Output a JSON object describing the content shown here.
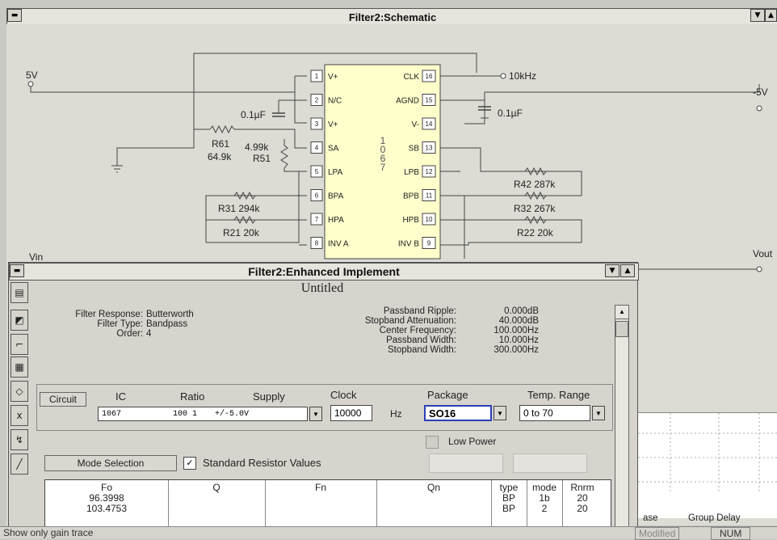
{
  "schematic": {
    "title": "Filter2:Schematic",
    "ic": {
      "part_digits": [
        "1",
        "0",
        "6",
        "7"
      ],
      "pins_left": [
        {
          "num": "1",
          "name": "V+"
        },
        {
          "num": "2",
          "name": "N/C"
        },
        {
          "num": "3",
          "name": "V+"
        },
        {
          "num": "4",
          "name": "SA"
        },
        {
          "num": "5",
          "name": "LPA"
        },
        {
          "num": "6",
          "name": "BPA"
        },
        {
          "num": "7",
          "name": "HPA"
        },
        {
          "num": "8",
          "name": "INV A"
        }
      ],
      "pins_right": [
        {
          "num": "16",
          "name": "CLK"
        },
        {
          "num": "15",
          "name": "AGND"
        },
        {
          "num": "14",
          "name": "V-"
        },
        {
          "num": "13",
          "name": "SB"
        },
        {
          "num": "12",
          "name": "LPB"
        },
        {
          "num": "11",
          "name": "BPB"
        },
        {
          "num": "10",
          "name": "HPB"
        },
        {
          "num": "9",
          "name": "INV B"
        }
      ]
    },
    "labels": {
      "vplus": "5V",
      "vminus": "-5V",
      "clock": "10kHz",
      "cap_left": "0.1µF",
      "cap_right": "0.1µF",
      "r61_name": "R61",
      "r61_val": "64.9k",
      "r51_val": "4.99k",
      "r51_name": "R51",
      "r31": "R31 294k",
      "r21": "R21 20k",
      "r42": "R42 287k",
      "r32": "R32 267k",
      "r22": "R22 20k",
      "vin": "Vin",
      "vout": "Vout"
    }
  },
  "dialog": {
    "title": "Filter2:Enhanced Implement",
    "subtitle": "Untitled",
    "summary_left": [
      {
        "label": "Filter Response:",
        "value": "Butterworth"
      },
      {
        "label": "Filter Type:",
        "value": "Bandpass"
      },
      {
        "label": "Order:",
        "value": "4"
      }
    ],
    "summary_right": [
      {
        "label": "Passband Ripple:",
        "value": "0.000dB"
      },
      {
        "label": "Stopband Attenuation:",
        "value": "40.000dB"
      },
      {
        "label": "Center Frequency:",
        "value": "100.000Hz"
      },
      {
        "label": "Passband Width:",
        "value": "10.000Hz"
      },
      {
        "label": "Stopband Width:",
        "value": "300.000Hz"
      }
    ],
    "circuit_button": "Circuit",
    "headers": {
      "ic": "IC",
      "ratio": "Ratio",
      "supply": "Supply",
      "clock": "Clock",
      "package": "Package",
      "temp": "Temp. Range"
    },
    "ic_select": {
      "ic": "1067",
      "ratio": "100 1",
      "supply": "+/-5.0V"
    },
    "clock_value": "10000",
    "clock_unit": "Hz",
    "package_value": "SO16",
    "temp_value": "0 to 70",
    "low_power": "Low Power",
    "mode_selection": "Mode Selection",
    "standard_resistors": "Standard Resistor Values",
    "table": {
      "headers": [
        "Fo",
        "Q",
        "Fn",
        "Qn",
        "type",
        "mode",
        "Rnrm"
      ],
      "rows": [
        {
          "fo": "96.3998",
          "type": "BP",
          "mode": "1b",
          "rnrm": "20"
        },
        {
          "fo": "103.4753",
          "type": "BP",
          "mode": "2",
          "rnrm": "20"
        }
      ]
    }
  },
  "background_window": {
    "labels": [
      "ase",
      "Group Delay"
    ]
  },
  "status_bar": {
    "message": "Show only gain trace",
    "modified": "Modified",
    "num": "NUM"
  }
}
